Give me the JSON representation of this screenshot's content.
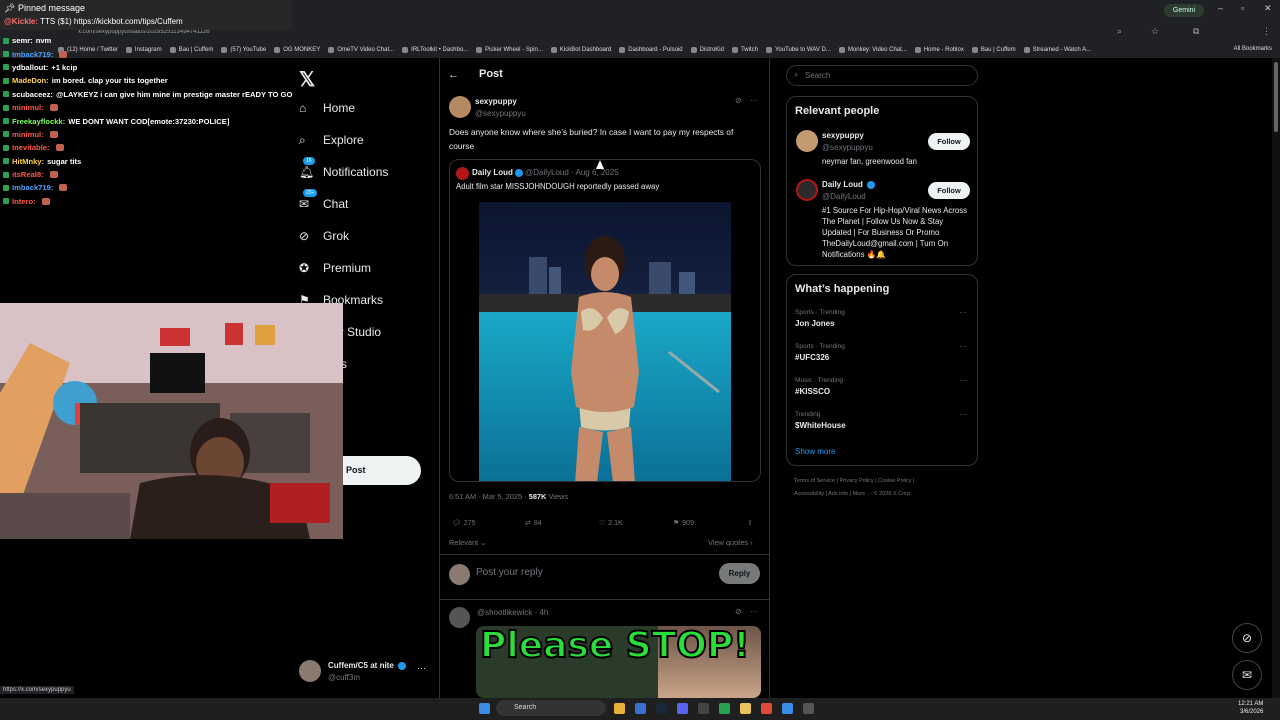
{
  "browser": {
    "url": "x.com/sexypuppyu/status/2029525113494741126",
    "profile_badge": "Gemini",
    "all_bookmarks": "All Bookmarks",
    "bookmarks": [
      "(12) Home / Twitter",
      "Instagram",
      "Bau | Cuffem",
      "(57) YouTube",
      "OG MONKEY",
      "OmeTV Video Chat...",
      "IRLToolkit • Dashbo...",
      "Picker Wheel - Spin...",
      "KickBot Dashboard",
      "Dashboard - Pulsoid",
      "DistroKid",
      "Twitch",
      "YouTube to WAV D...",
      "Monkey: Video Chat...",
      "Home - Roblox",
      "Bau | Cuffem",
      "Streamed - Watch A..."
    ],
    "status_url": "https://x.com/sexypuppyu"
  },
  "chat": {
    "pinned_header": "Pinned message",
    "pinned_user": "@Kickle:",
    "pinned_text": "TTS ($1) https://kickbot.com/tips/Cuffem",
    "messages": [
      {
        "user": "semr:",
        "msg": "nvm",
        "color": "#ffffff"
      },
      {
        "user": "Imback719:",
        "msg": "",
        "color": "#4aa0ff",
        "emote": true
      },
      {
        "user": "ydballout:",
        "msg": "+1 kcip",
        "color": "#ffffff"
      },
      {
        "user": "MadeDon:",
        "msg": "im bored. clap your tits together",
        "color": "#ffd34a"
      },
      {
        "user": "scubaceez:",
        "msg": "@LAYKEYZ i can give him mine im prestige master rEADY TO GO",
        "color": "#ffffff"
      },
      {
        "user": "minimul:",
        "msg": "",
        "color": "#ff5a4a",
        "emote": true
      },
      {
        "user": "Freekayflockk:",
        "msg": "WE DONT WANT COD[emote:37230:POLICE]",
        "color": "#7cff5a"
      },
      {
        "user": "minimul:",
        "msg": "",
        "color": "#ff5a4a",
        "emote": true
      },
      {
        "user": "Inevitable:",
        "msg": "",
        "color": "#ff5a4a",
        "emote": true
      },
      {
        "user": "HitMnky:",
        "msg": "sugar tits",
        "color": "#ffd34a"
      },
      {
        "user": "itsReal8:",
        "msg": "",
        "color": "#ff5a4a",
        "emote": true
      },
      {
        "user": "Imback719:",
        "msg": "",
        "color": "#4aa0ff",
        "emote": true
      },
      {
        "user": "Intero:",
        "msg": "",
        "color": "#ff5a4a",
        "emote": true
      }
    ]
  },
  "nav": {
    "items": [
      {
        "label": "Home",
        "icon": "home-icon"
      },
      {
        "label": "Explore",
        "icon": "search-icon"
      },
      {
        "label": "Notifications",
        "icon": "bell-icon",
        "badge": "16"
      },
      {
        "label": "Chat",
        "icon": "mail-icon",
        "badge": "20+"
      },
      {
        "label": "Grok",
        "icon": "grok-icon"
      },
      {
        "label": "Premium",
        "icon": "premium-icon"
      },
      {
        "label": "Bookmarks",
        "icon": "bookmark-icon"
      },
      {
        "label": "ator Studio",
        "icon": "studio-icon"
      },
      {
        "label": "icles",
        "icon": "article-icon"
      },
      {
        "label": "file",
        "icon": "profile-icon"
      },
      {
        "label": "re",
        "icon": "more-icon"
      }
    ],
    "post_button": "Post",
    "account_name": "Cuffem/C5 at nite",
    "account_handle": "@cuff3m"
  },
  "post": {
    "header": "Post",
    "author_name": "sexypuppy",
    "author_handle": "@sexypuppyu",
    "text": "Does anyone know where she’s buried? In case I want to pay my respects of course",
    "quote": {
      "name": "Daily Loud",
      "handle": "@DailyLoud",
      "date": "· Aug 6, 2025",
      "text": "Adult film star MISSJOHNDOUGH reportedly passed away"
    },
    "time": "6:51 AM · Mar 5, 2025 ·",
    "views_count": "587K",
    "views_label": "Views",
    "replies": "275",
    "reposts": "84",
    "likes": "2.1K",
    "bookmarks": "909",
    "sort_label": "Relevant",
    "view_quotes": "View quotes",
    "reply_placeholder": "Post your reply",
    "reply_button": "Reply",
    "comment_handle": "@shootlikewick",
    "comment_age": "· 4h",
    "comment_image_text": "Please STOP!"
  },
  "sidebar": {
    "search_placeholder": "Search",
    "relevant_title": "Relevant people",
    "people": [
      {
        "name": "sexypuppy",
        "handle": "@sexypuppyu",
        "bio": "neymar fan, greenwood fan",
        "follow": "Follow"
      },
      {
        "name": "Daily Loud",
        "handle": "@DailyLoud",
        "bio": "#1 Source For Hip-Hop/Viral News Across The Planet | Follow Us Now & Stay Updated | For Business Or Promo TheDailyLoud@gmail.com | Turn On Notifications 🔥🔔",
        "follow": "Follow"
      }
    ],
    "happening_title": "What’s happening",
    "trends": [
      {
        "category": "Sports · Trending",
        "name": "Jon Jones"
      },
      {
        "category": "Sports · Trending",
        "name": "#UFC326"
      },
      {
        "category": "Music · Trending",
        "name": "#KISSCO"
      },
      {
        "category": "Trending",
        "name": "$WhiteHouse"
      }
    ],
    "show_more": "Show more",
    "footer_line1": "Terms of Service  |  Privacy Policy  |  Cookie Policy  |",
    "footer_line2": "Accessibility  |  Ads info  |  More ···  © 2026 X Corp."
  },
  "taskbar": {
    "search": "Search",
    "time": "12:21 AM",
    "date": "3/6/2026"
  },
  "colors": {
    "accent": "#1d9bf0",
    "background": "#000000",
    "border": "#2f3336",
    "muted": "#71767b"
  }
}
